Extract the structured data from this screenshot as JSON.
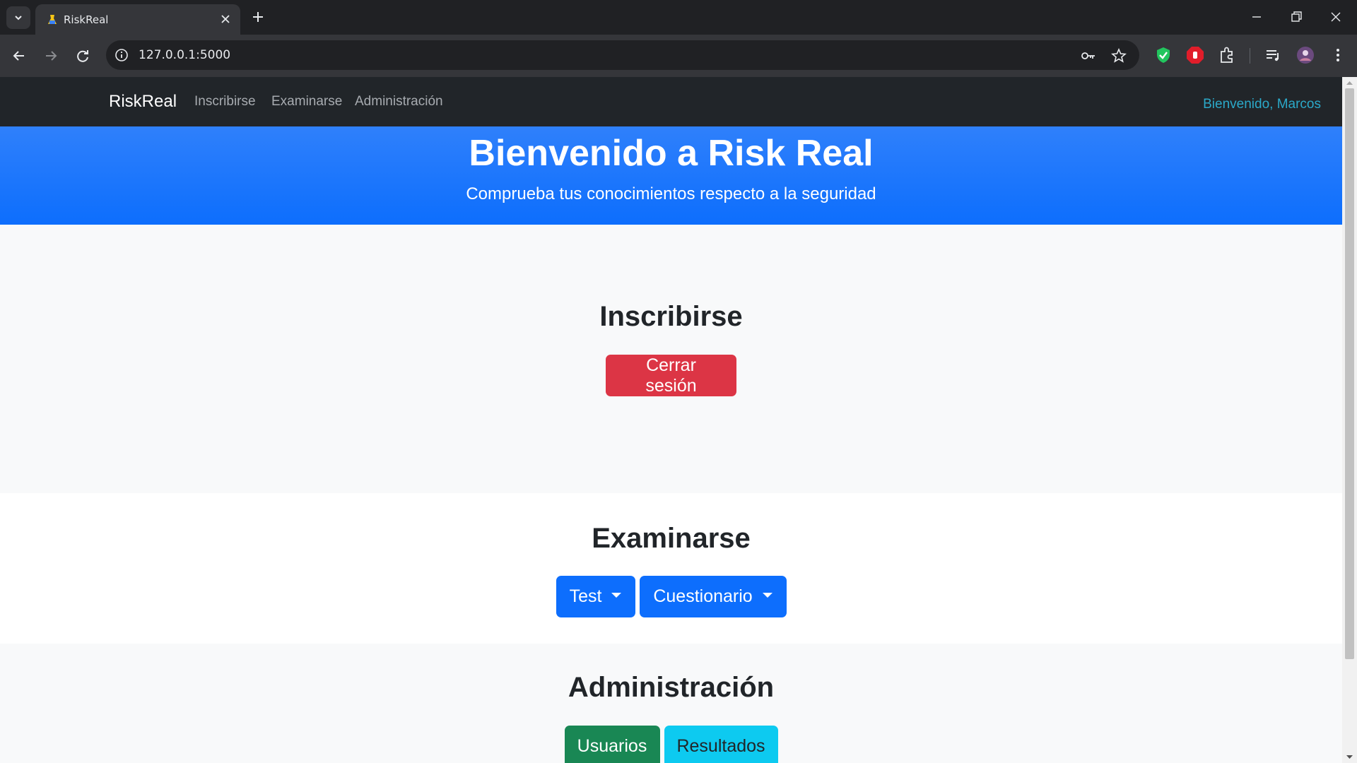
{
  "browser": {
    "tab_title": "RiskReal",
    "url": "127.0.0.1:5000"
  },
  "site": {
    "brand": "RiskReal",
    "nav": [
      "Inscribirse",
      "Examinarse",
      "Administración"
    ],
    "welcome": "Bienvenido, Marcos"
  },
  "hero": {
    "title": "Bienvenido a Risk Real",
    "subtitle": "Comprueba tus conocimientos respecto a la seguridad"
  },
  "sections": {
    "inscribirse": {
      "title": "Inscribirse",
      "logout_label": "Cerrar sesión"
    },
    "examinarse": {
      "title": "Examinarse",
      "test_label": "Test",
      "cuestionario_label": "Cuestionario"
    },
    "administracion": {
      "title": "Administración",
      "usuarios_label": "Usuarios",
      "resultados_label": "Resultados"
    }
  },
  "colors": {
    "navbar": "#212529",
    "hero": "#0d6efd",
    "danger": "#dc3545",
    "primary": "#0d6efd",
    "success": "#198754",
    "info": "#0dcaf0",
    "welcome_link": "#2ba9c9"
  },
  "icons": {
    "tab_search": "chevron-down-icon",
    "favicon": "flask-icon",
    "tab_close": "close-icon",
    "new_tab": "plus-icon",
    "back": "arrow-left-icon",
    "forward": "arrow-right-icon",
    "reload": "reload-icon",
    "site_info": "info-icon",
    "password": "key-icon",
    "bookmark": "star-icon",
    "extensions": [
      "shield-check-icon",
      "stop-hand-icon",
      "puzzle-icon",
      "media-queue-icon",
      "avatar-icon",
      "kebab-menu-icon"
    ]
  }
}
